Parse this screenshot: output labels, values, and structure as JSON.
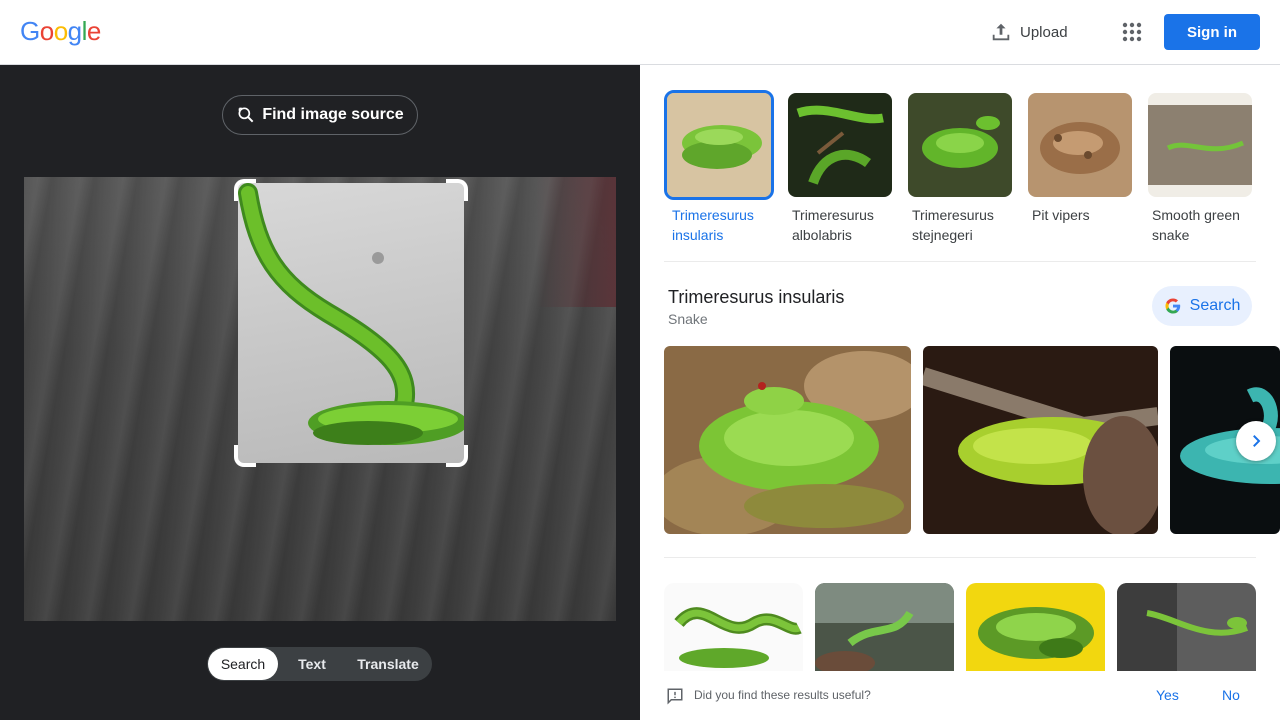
{
  "header": {
    "logo": [
      "G",
      "o",
      "o",
      "g",
      "l",
      "e"
    ],
    "logo_colors": [
      "#4285f4",
      "#ea4335",
      "#fbbc05",
      "#4285f4",
      "#34a853",
      "#ea4335"
    ],
    "upload_label": "Upload",
    "apps_icon": "apps-grid-icon",
    "signin_label": "Sign in"
  },
  "left": {
    "find_source_label": "Find image source",
    "mode_tabs": [
      {
        "label": "Search",
        "active": true
      },
      {
        "label": "Text",
        "active": false
      },
      {
        "label": "Translate",
        "active": false
      }
    ]
  },
  "right": {
    "chips": [
      {
        "label": "Trimeresurus insularis",
        "selected": true
      },
      {
        "label": "Trimeresurus albolabris",
        "selected": false
      },
      {
        "label": "Trimeresurus stejnegeri",
        "selected": false
      },
      {
        "label": "Pit vipers",
        "selected": false
      },
      {
        "label": "Smooth green snake",
        "selected": false
      }
    ],
    "entity": {
      "title": "Trimeresurus insularis",
      "subtitle": "Snake",
      "search_label": "Search"
    },
    "feedback": {
      "question": "Did you find these results useful?",
      "yes": "Yes",
      "no": "No"
    }
  },
  "colors": {
    "accent": "#1a73e8",
    "dark_pane": "#202124",
    "snake_green": "#6cbf2a"
  }
}
